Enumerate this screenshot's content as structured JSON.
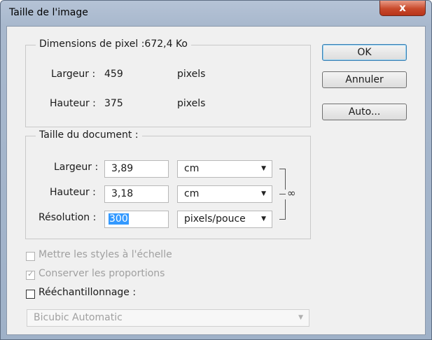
{
  "window": {
    "title": "Taille de l'image",
    "close_label": "x"
  },
  "pixel_dimensions": {
    "legend": "Dimensions de pixel :672,4 Ko",
    "width_label": "Largeur :",
    "width_value": "459",
    "width_unit": "pixels",
    "height_label": "Hauteur :",
    "height_value": "375",
    "height_unit": "pixels"
  },
  "document_size": {
    "legend": "Taille du document :",
    "width_label": "Largeur :",
    "width_value": "3,89",
    "width_unit": "cm",
    "height_label": "Hauteur :",
    "height_value": "3,18",
    "height_unit": "cm",
    "resolution_label": "Résolution :",
    "resolution_value": "300",
    "resolution_unit": "pixels/pouce"
  },
  "buttons": {
    "ok": "OK",
    "cancel": "Annuler",
    "auto": "Auto..."
  },
  "options": {
    "scale_styles": {
      "label": "Mettre les styles à l'échelle",
      "checked": false,
      "enabled": false
    },
    "constrain": {
      "label": "Conserver les proportions",
      "checked": true,
      "enabled": false
    },
    "resample": {
      "label": "Rééchantillonnage :",
      "checked": false,
      "enabled": true
    },
    "resample_method": "Bicubic Automatic"
  }
}
